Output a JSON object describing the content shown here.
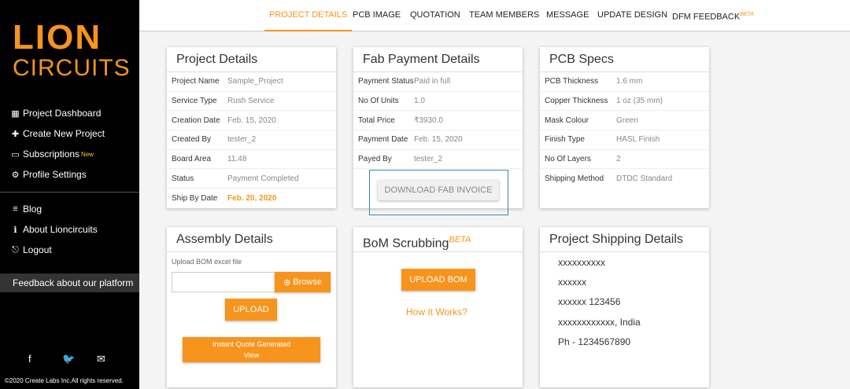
{
  "brand": {
    "logo_line1": "LION",
    "logo_line2": "CIRCUITS",
    "accent_color": "#f7941d"
  },
  "sidebar": {
    "items_top": [
      {
        "icon": "grid-icon",
        "label": "Project Dashboard"
      },
      {
        "icon": "plus-icon",
        "label": "Create New Project"
      },
      {
        "icon": "monitor-icon",
        "label": "Subscriptions",
        "badge": "New"
      },
      {
        "icon": "gear-icon",
        "label": "Profile Settings"
      }
    ],
    "items_bottom": [
      {
        "icon": "list-icon",
        "label": "Blog"
      },
      {
        "icon": "info-icon",
        "label": "About Lioncircuits"
      },
      {
        "icon": "logout-icon",
        "label": "Logout"
      }
    ],
    "feedback_label": "Feedback about our platform",
    "socials": [
      "facebook-icon",
      "twitter-icon",
      "mail-icon"
    ],
    "copyright": "©2020 Create Labs Inc.All rights reserved."
  },
  "tabs": [
    {
      "label": "PROJECT DETAILS",
      "active": true
    },
    {
      "label": "PCB IMAGE"
    },
    {
      "label": "QUOTATION"
    },
    {
      "label": "TEAM MEMBERS"
    },
    {
      "label": "MESSAGE"
    },
    {
      "label": "UPDATE DESIGN"
    },
    {
      "label": "DFM FEEDBACK",
      "badge": "BETA"
    }
  ],
  "project_details": {
    "title": "Project Details",
    "rows": [
      {
        "k": "Project Name",
        "v": "Sample_Project"
      },
      {
        "k": "Service Type",
        "v": "Rush Service"
      },
      {
        "k": "Creation Date",
        "v": "Feb. 15, 2020"
      },
      {
        "k": "Created By",
        "v": "tester_2"
      },
      {
        "k": "Board Area",
        "v": "11.48"
      },
      {
        "k": "Status",
        "v": "Payment Completed"
      },
      {
        "k": "Ship By Date",
        "v": "Feb. 20, 2020"
      }
    ]
  },
  "fab_payment": {
    "title": "Fab Payment Details",
    "rows": [
      {
        "k": "Payment Status",
        "v": "Paid in full"
      },
      {
        "k": "No Of Units",
        "v": "1.0"
      },
      {
        "k": "Total Price",
        "v": "₹3930.0"
      },
      {
        "k": "Payment Date",
        "v": "Feb. 15, 2020"
      },
      {
        "k": "Payed By",
        "v": "tester_2"
      }
    ],
    "invoice_button": "DOWNLOAD FAB INVOICE"
  },
  "pcb_specs": {
    "title": "PCB Specs",
    "rows": [
      {
        "k": "PCB Thickness",
        "v": "1.6 mm"
      },
      {
        "k": "Copper Thickness",
        "v": "1 oz (35 mm)"
      },
      {
        "k": "Mask Colour",
        "v": "Green"
      },
      {
        "k": "Finish Type",
        "v": "HASL Finish"
      },
      {
        "k": "No Of Layers",
        "v": "2"
      },
      {
        "k": "Shipping Method",
        "v": "DTDC Standard"
      }
    ]
  },
  "assembly": {
    "title": "Assembly Details",
    "upload_label": "Upload BOM excel file",
    "browse_label": "Browse",
    "upload_button": "UPLOAD",
    "quote_line1": "Instant Quote Generated",
    "quote_line2": "View"
  },
  "bom": {
    "title": "BoM Scrubbing",
    "badge": "BETA",
    "upload_button": "UPLOAD BOM",
    "how_link": "How It Works?"
  },
  "shipping": {
    "title": "Project Shipping Details",
    "lines": [
      "xxxxxxxxxx",
      "xxxxxx",
      "xxxxxx 123456",
      "xxxxxxxxxxxx, India",
      "Ph - 1234567890"
    ]
  }
}
